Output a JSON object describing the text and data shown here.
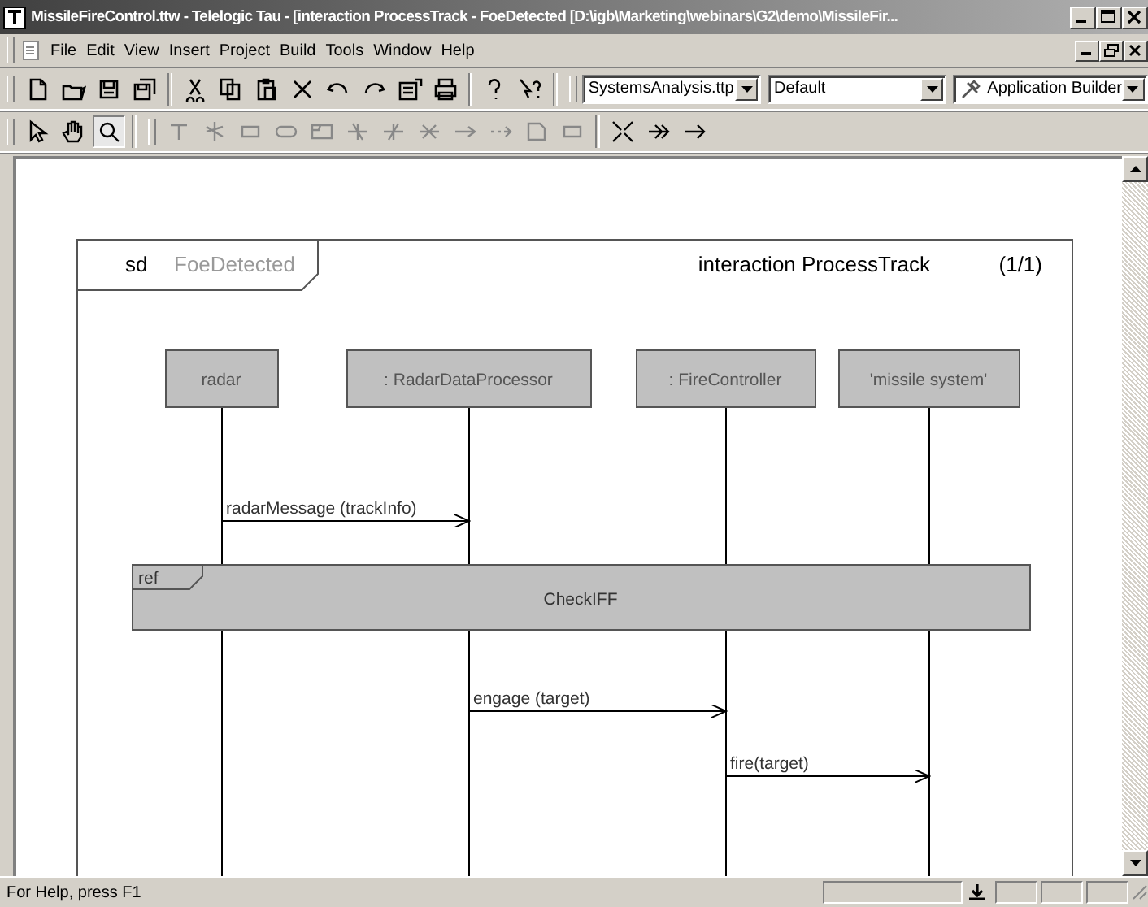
{
  "window": {
    "title": "MissileFireControl.ttw - Telelogic Tau - [interaction ProcessTrack - FoeDetected [D:\\igb\\Marketing\\webinars\\G2\\demo\\MissileFir..."
  },
  "menu": [
    "File",
    "Edit",
    "View",
    "Insert",
    "Project",
    "Build",
    "Tools",
    "Window",
    "Help"
  ],
  "toolbar": {
    "combos": [
      {
        "value": "SystemsAnalysis.ttp"
      },
      {
        "value": "Default"
      },
      {
        "value": "Application Builder"
      }
    ]
  },
  "diagram": {
    "frame": {
      "keyword": "sd",
      "name": "FoeDetected",
      "heading_keyword": "interaction",
      "heading_name": "ProcessTrack",
      "page": "(1/1)"
    },
    "lifelines": [
      "radar",
      ": RadarDataProcessor",
      ": FireController",
      "'missile system'"
    ],
    "items": [
      {
        "kind": "message",
        "label": "radarMessage (trackInfo)"
      },
      {
        "kind": "ref",
        "keyword": "ref",
        "label": "CheckIFF"
      },
      {
        "kind": "message",
        "label": "engage (target)"
      },
      {
        "kind": "message",
        "label": "fire(target)"
      }
    ]
  },
  "status_bar": {
    "text": "For Help, press F1"
  }
}
